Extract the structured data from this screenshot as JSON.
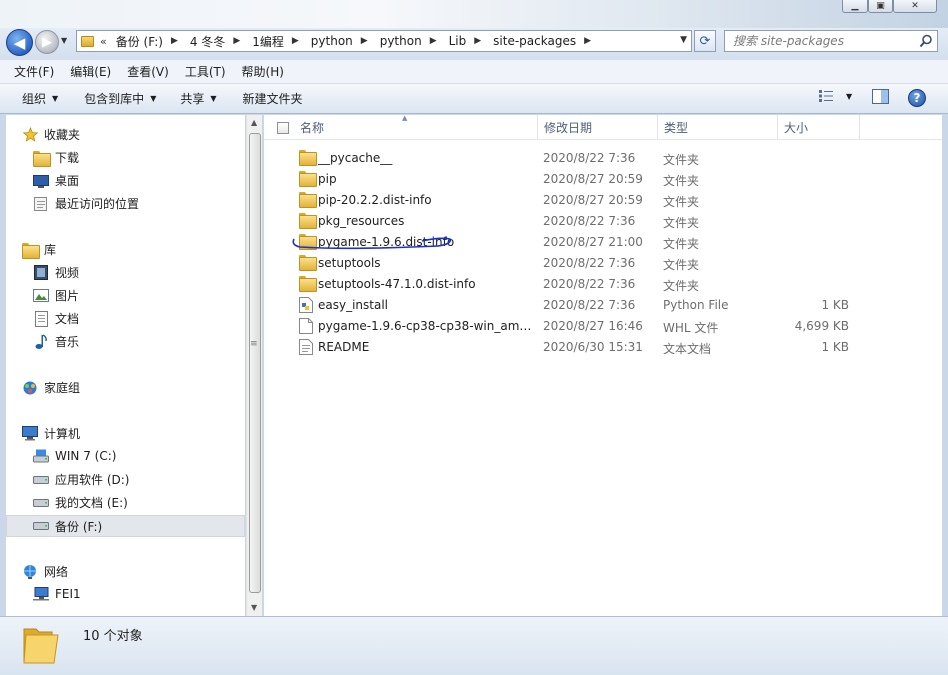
{
  "window": {
    "min_icon": "minimize-icon",
    "max_icon": "maximize-icon",
    "close_icon": "close-icon"
  },
  "address": {
    "overflow": "«",
    "crumbs": [
      "备份 (F:)",
      "4 冬冬",
      "1编程",
      "python",
      "python",
      "Lib",
      "site-packages"
    ]
  },
  "search": {
    "placeholder": "搜索 site-packages"
  },
  "menu": [
    "文件(F)",
    "编辑(E)",
    "查看(V)",
    "工具(T)",
    "帮助(H)"
  ],
  "toolbar": {
    "organize": "组织",
    "include": "包含到库中",
    "share": "共享",
    "new_folder": "新建文件夹"
  },
  "sidebar": {
    "favorites": {
      "label": "收藏夹",
      "items": [
        "下载",
        "桌面",
        "最近访问的位置"
      ]
    },
    "libraries": {
      "label": "库",
      "items": [
        "视频",
        "图片",
        "文档",
        "音乐"
      ]
    },
    "homegroup": "家庭组",
    "computer": {
      "label": "计算机",
      "items": [
        "WIN 7 (C:)",
        "应用软件 (D:)",
        "我的文档 (E:)",
        "备份 (F:)"
      ]
    },
    "network": {
      "label": "网络",
      "items": [
        "FEI1"
      ]
    }
  },
  "columns": {
    "name": "名称",
    "date": "修改日期",
    "type": "类型",
    "size": "大小"
  },
  "files": [
    {
      "name": "__pycache__",
      "date": "2020/8/22 7:36",
      "type": "文件夹",
      "size": "",
      "icon": "folder"
    },
    {
      "name": "pip",
      "date": "2020/8/27 20:59",
      "type": "文件夹",
      "size": "",
      "icon": "folder"
    },
    {
      "name": "pip-20.2.2.dist-info",
      "date": "2020/8/27 20:59",
      "type": "文件夹",
      "size": "",
      "icon": "folder"
    },
    {
      "name": "pkg_resources",
      "date": "2020/8/22 7:36",
      "type": "文件夹",
      "size": "",
      "icon": "folder"
    },
    {
      "name": "pygame-1.9.6.dist-info",
      "date": "2020/8/27 21:00",
      "type": "文件夹",
      "size": "",
      "icon": "folder",
      "annotated": true
    },
    {
      "name": "setuptools",
      "date": "2020/8/22 7:36",
      "type": "文件夹",
      "size": "",
      "icon": "folder"
    },
    {
      "name": "setuptools-47.1.0.dist-info",
      "date": "2020/8/22 7:36",
      "type": "文件夹",
      "size": "",
      "icon": "folder"
    },
    {
      "name": "easy_install",
      "date": "2020/8/22 7:36",
      "type": "Python File",
      "size": "1 KB",
      "icon": "python-file"
    },
    {
      "name": "pygame-1.9.6-cp38-cp38-win_amd...",
      "date": "2020/8/27 16:46",
      "type": "WHL 文件",
      "size": "4,699 KB",
      "icon": "file"
    },
    {
      "name": "README",
      "date": "2020/6/30 15:31",
      "type": "文本文档",
      "size": "1 KB",
      "icon": "text-file"
    }
  ],
  "status": {
    "count": "10 个对象"
  },
  "colors": {
    "annotation": "#1a2fd6",
    "selection": "#e3e6ea"
  }
}
